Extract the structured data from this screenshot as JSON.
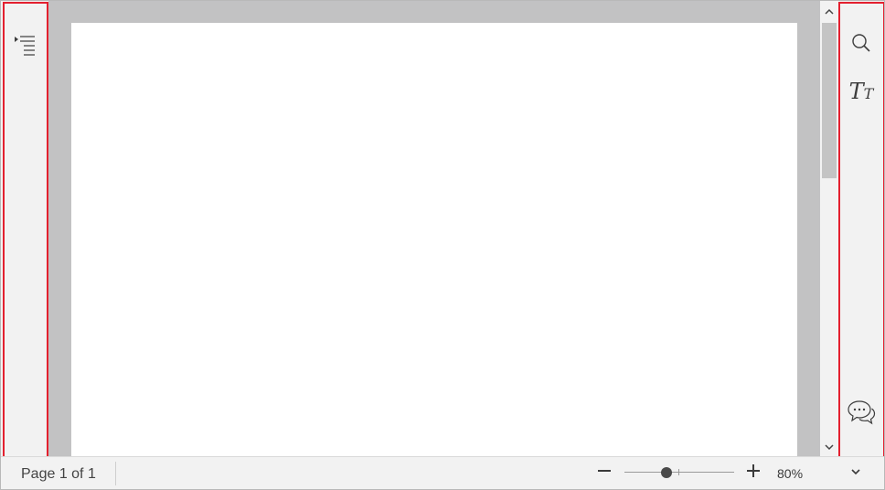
{
  "icons": {
    "toc": "table-of-contents-icon",
    "search": "search-icon",
    "text_size": "text-size-icon",
    "comments": "comments-icon",
    "scroll_up": "chevron-up-icon",
    "scroll_down": "chevron-down-icon",
    "zoom_out": "minus-icon",
    "zoom_in": "plus-icon",
    "more": "chevron-down-icon"
  },
  "text_size_button": {
    "glyph_large": "T",
    "glyph_small": "T"
  },
  "status_bar": {
    "page_indicator": "Page 1 of 1",
    "zoom_label": "80%",
    "zoom_percent": 80,
    "zoom_slider_fraction": 0.38
  },
  "colors": {
    "highlight_border": "#e3202f",
    "canvas_background": "#c2c2c3",
    "panel_background": "#f2f2f2",
    "page": "#ffffff"
  }
}
